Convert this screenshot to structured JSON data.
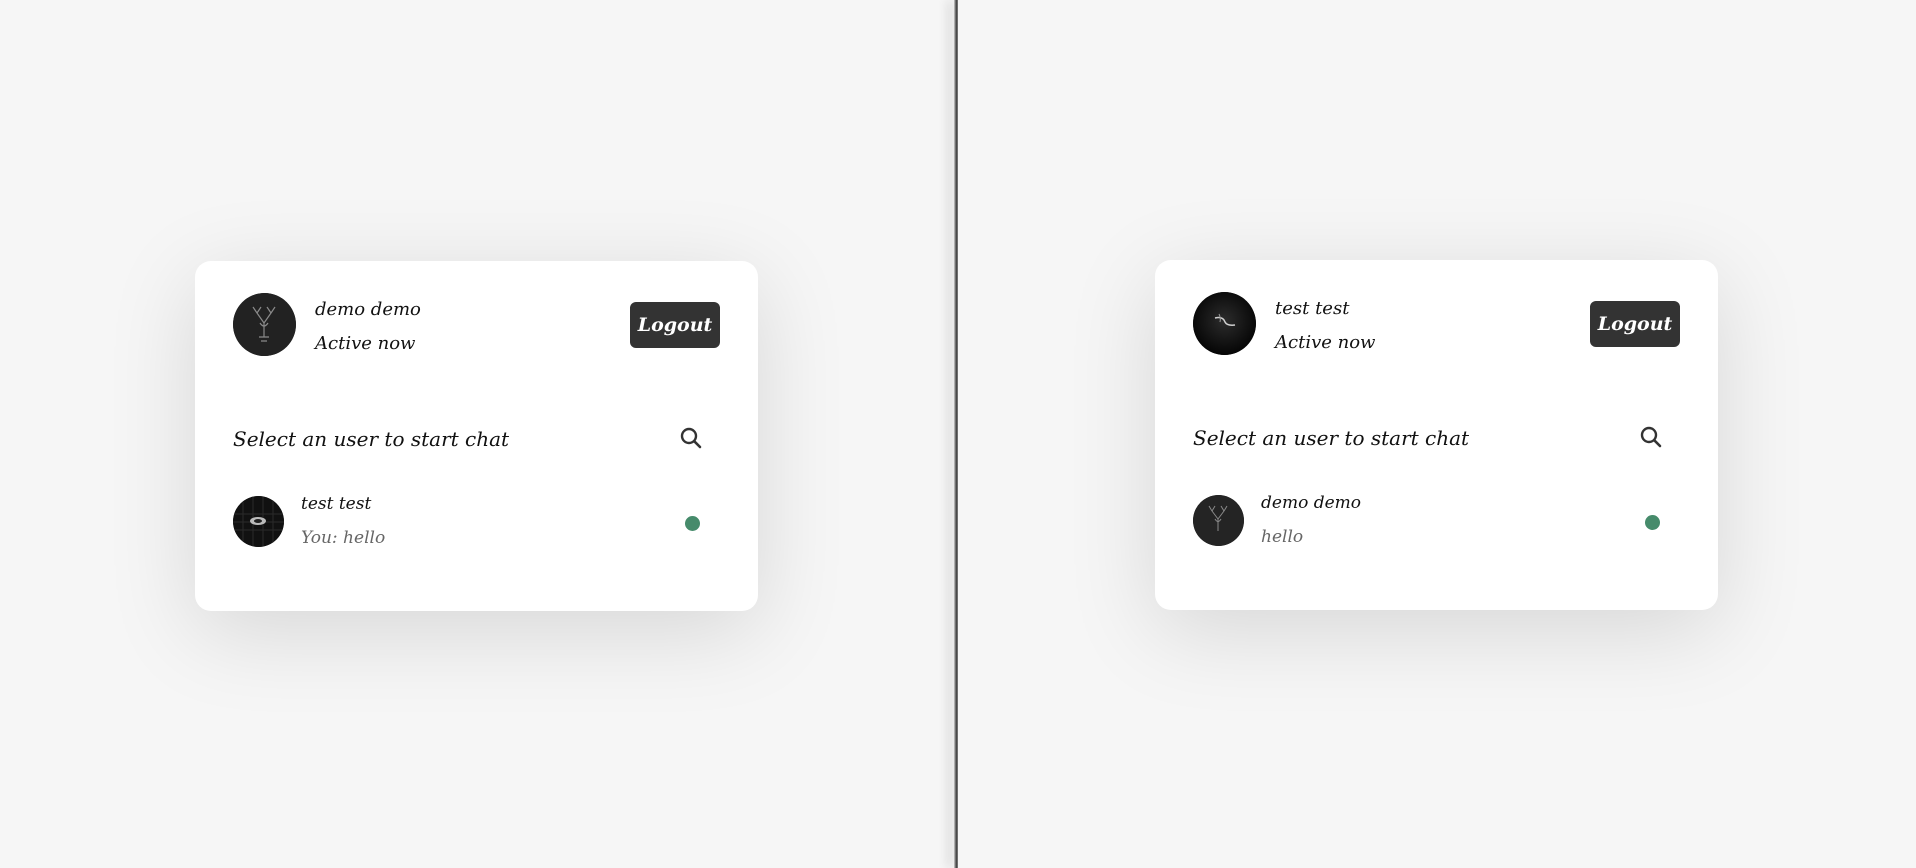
{
  "left_window": {
    "header": {
      "name": "demo demo",
      "status": "Active now",
      "logout_label": "Logout",
      "avatar_icon": "deer-avatar-icon"
    },
    "search": {
      "label": "Select an user to start chat",
      "icon": "search-icon"
    },
    "users": [
      {
        "name": "test test",
        "last_message": "You: hello",
        "online": true,
        "status_color": "#468b6b",
        "avatar_icon": "dark-avatar-icon"
      }
    ]
  },
  "right_window": {
    "header": {
      "name": "test test",
      "status": "Active now",
      "logout_label": "Logout",
      "avatar_icon": "dark-avatar-icon"
    },
    "search": {
      "label": "Select an user to start chat",
      "icon": "search-icon"
    },
    "users": [
      {
        "name": "demo demo",
        "last_message": "hello",
        "online": true,
        "status_color": "#468b6b",
        "avatar_icon": "deer-avatar-icon"
      }
    ]
  },
  "colors": {
    "background": "#f6f6f6",
    "button": "#333333",
    "online": "#468b6b"
  }
}
